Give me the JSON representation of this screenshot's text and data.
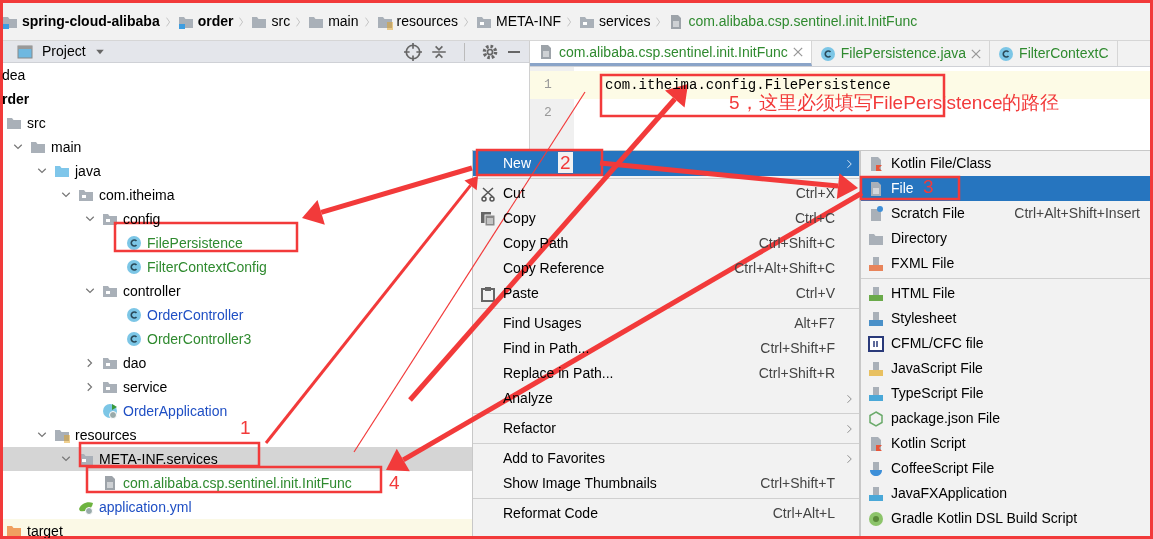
{
  "breadcrumb": [
    {
      "label": "spring-cloud-alibaba",
      "kind": "module",
      "color": "#000000"
    },
    {
      "label": "order",
      "kind": "module",
      "color": "#000000"
    },
    {
      "label": "src",
      "kind": "folder",
      "color": "#000000"
    },
    {
      "label": "main",
      "kind": "folder",
      "color": "#000000"
    },
    {
      "label": "resources",
      "kind": "resources",
      "color": "#000000"
    },
    {
      "label": "META-INF",
      "kind": "package",
      "color": "#000000"
    },
    {
      "label": "services",
      "kind": "package",
      "color": "#000000"
    },
    {
      "label": "com.alibaba.csp.sentinel.init.InitFunc",
      "kind": "file",
      "color": "#2f8a2f"
    }
  ],
  "project_panel": {
    "title": "Project"
  },
  "tree": [
    {
      "label": "dea",
      "kind": "plain",
      "color": "#000000",
      "selected": false
    },
    {
      "label": "rder",
      "kind": "module",
      "color": "#000000",
      "selected": false,
      "children": [
        {
          "label": "src",
          "kind": "folder",
          "color": "#000000",
          "selected": false,
          "expanded": true,
          "children": [
            {
              "label": "main",
              "kind": "folder",
              "color": "#000000",
              "selected": false,
              "expanded": true,
              "children": [
                {
                  "label": "java",
                  "kind": "source",
                  "color": "#000000",
                  "selected": false,
                  "expanded": true,
                  "children": [
                    {
                      "label": "com.itheima",
                      "kind": "package",
                      "color": "#000000",
                      "selected": false,
                      "expanded": true,
                      "children": [
                        {
                          "label": "config",
                          "kind": "package",
                          "color": "#000000",
                          "selected": false,
                          "expanded": true,
                          "children": [
                            {
                              "label": "FilePersistence",
                              "kind": "class",
                              "color": "#2f8a2f",
                              "selected": false
                            },
                            {
                              "label": "FilterContextConfig",
                              "kind": "class",
                              "color": "#2f8a2f",
                              "selected": false
                            }
                          ]
                        },
                        {
                          "label": "controller",
                          "kind": "package",
                          "color": "#000000",
                          "selected": false,
                          "expanded": true,
                          "children": [
                            {
                              "label": "OrderController",
                              "kind": "class",
                              "color": "#1f4fc4",
                              "selected": false
                            },
                            {
                              "label": "OrderController3",
                              "kind": "class",
                              "color": "#2f8a2f",
                              "selected": false
                            }
                          ]
                        },
                        {
                          "label": "dao",
                          "kind": "package",
                          "color": "#000000",
                          "selected": false,
                          "expanded": false
                        },
                        {
                          "label": "service",
                          "kind": "package",
                          "color": "#000000",
                          "selected": false,
                          "expanded": false
                        },
                        {
                          "label": "OrderApplication",
                          "kind": "app",
                          "color": "#1f4fc4",
                          "selected": false
                        }
                      ]
                    }
                  ]
                },
                {
                  "label": "resources",
                  "kind": "resources",
                  "color": "#000000",
                  "selected": false,
                  "expanded": true,
                  "children": [
                    {
                      "label": "META-INF.services",
                      "kind": "package",
                      "color": "#000000",
                      "selected": true,
                      "expanded": true,
                      "children": [
                        {
                          "label": "com.alibaba.csp.sentinel.init.InitFunc",
                          "kind": "file",
                          "color": "#2f8a2f",
                          "selected": false
                        }
                      ]
                    },
                    {
                      "label": "application.yml",
                      "kind": "yaml",
                      "color": "#1f4fc4",
                      "selected": false
                    }
                  ]
                }
              ]
            }
          ]
        },
        {
          "label": "target",
          "kind": "excluded",
          "color": "#000000",
          "selected": false
        }
      ]
    }
  ],
  "tabs": [
    {
      "label": "com.alibaba.csp.sentinel.init.InitFunc",
      "kind": "file",
      "color": "#2f8a2f",
      "selected": true,
      "closable": true
    },
    {
      "label": "FilePersistence.java",
      "kind": "class",
      "color": "#2f8a2f",
      "selected": false,
      "closable": true
    },
    {
      "label": "FilterContextC",
      "kind": "class",
      "color": "#2f8a2f",
      "selected": false,
      "closable": false
    }
  ],
  "editor": {
    "lines": [
      {
        "number": "1",
        "text": "com.itheima.config.FilePersistence",
        "current": true
      },
      {
        "number": "2",
        "current": false
      }
    ]
  },
  "context_menu": {
    "sections": [
      [
        {
          "label": "New",
          "kind": "plain",
          "submenu": true,
          "selected": true
        }
      ],
      [
        {
          "label": "Cut",
          "kind": "cut",
          "shortcut": "Ctrl+X",
          "submenu": false,
          "selected": false
        },
        {
          "label": "Copy",
          "kind": "copy",
          "shortcut": "Ctrl+C",
          "submenu": false,
          "selected": false
        },
        {
          "label": "Copy Path",
          "kind": "plain",
          "shortcut": "Ctrl+Shift+C",
          "submenu": false,
          "selected": false
        },
        {
          "label": "Copy Reference",
          "kind": "plain",
          "shortcut": "Ctrl+Alt+Shift+C",
          "submenu": false,
          "selected": false
        },
        {
          "label": "Paste",
          "kind": "paste",
          "shortcut": "Ctrl+V",
          "submenu": false,
          "selected": false
        }
      ],
      [
        {
          "label": "Find Usages",
          "kind": "plain",
          "shortcut": "Alt+F7",
          "submenu": false,
          "selected": false
        },
        {
          "label": "Find in Path...",
          "kind": "plain",
          "shortcut": "Ctrl+Shift+F",
          "submenu": false,
          "selected": false
        },
        {
          "label": "Replace in Path...",
          "kind": "plain",
          "shortcut": "Ctrl+Shift+R",
          "submenu": false,
          "selected": false
        },
        {
          "label": "Analyze",
          "kind": "plain",
          "submenu": true,
          "selected": false
        }
      ],
      [
        {
          "label": "Refactor",
          "kind": "plain",
          "submenu": true,
          "selected": false
        }
      ],
      [
        {
          "label": "Add to Favorites",
          "kind": "plain",
          "submenu": true,
          "selected": false
        },
        {
          "label": "Show Image Thumbnails",
          "kind": "plain",
          "shortcut": "Ctrl+Shift+T",
          "submenu": false,
          "selected": false
        }
      ],
      [
        {
          "label": "Reformat Code",
          "kind": "plain",
          "shortcut": "Ctrl+Alt+L",
          "submenu": false,
          "selected": false
        }
      ]
    ]
  },
  "new_submenu": {
    "sections": [
      [
        {
          "label": "Kotlin File/Class",
          "kind": "kotlin",
          "selected": false
        },
        {
          "label": "File",
          "kind": "file",
          "selected": true
        },
        {
          "label": "Scratch File",
          "kind": "scratch",
          "shortcut": "Ctrl+Alt+Shift+Insert",
          "selected": false
        },
        {
          "label": "Directory",
          "kind": "directory",
          "selected": false
        },
        {
          "label": "FXML File",
          "kind": "fxml",
          "selected": false
        }
      ],
      [
        {
          "label": "HTML File",
          "kind": "html",
          "selected": false
        },
        {
          "label": "Stylesheet",
          "kind": "css",
          "selected": false
        },
        {
          "label": "CFML/CFC file",
          "kind": "cfml",
          "selected": false
        },
        {
          "label": "JavaScript File",
          "kind": "js",
          "selected": false
        },
        {
          "label": "TypeScript File",
          "kind": "ts",
          "selected": false
        },
        {
          "label": "package.json File",
          "kind": "npm",
          "selected": false
        },
        {
          "label": "Kotlin Script",
          "kind": "kotlin",
          "selected": false
        },
        {
          "label": "CoffeeScript File",
          "kind": "coffee",
          "selected": false
        },
        {
          "label": "JavaFXApplication",
          "kind": "javafx",
          "selected": false
        },
        {
          "label": "Gradle Kotlin DSL Build Script",
          "kind": "gradle",
          "selected": false
        }
      ]
    ]
  },
  "annotations": [
    {
      "text": "1"
    },
    {
      "text": "2"
    },
    {
      "text": "3"
    },
    {
      "text": "4"
    },
    {
      "text": "5，这里必须填写FilePersistence的路径"
    }
  ]
}
